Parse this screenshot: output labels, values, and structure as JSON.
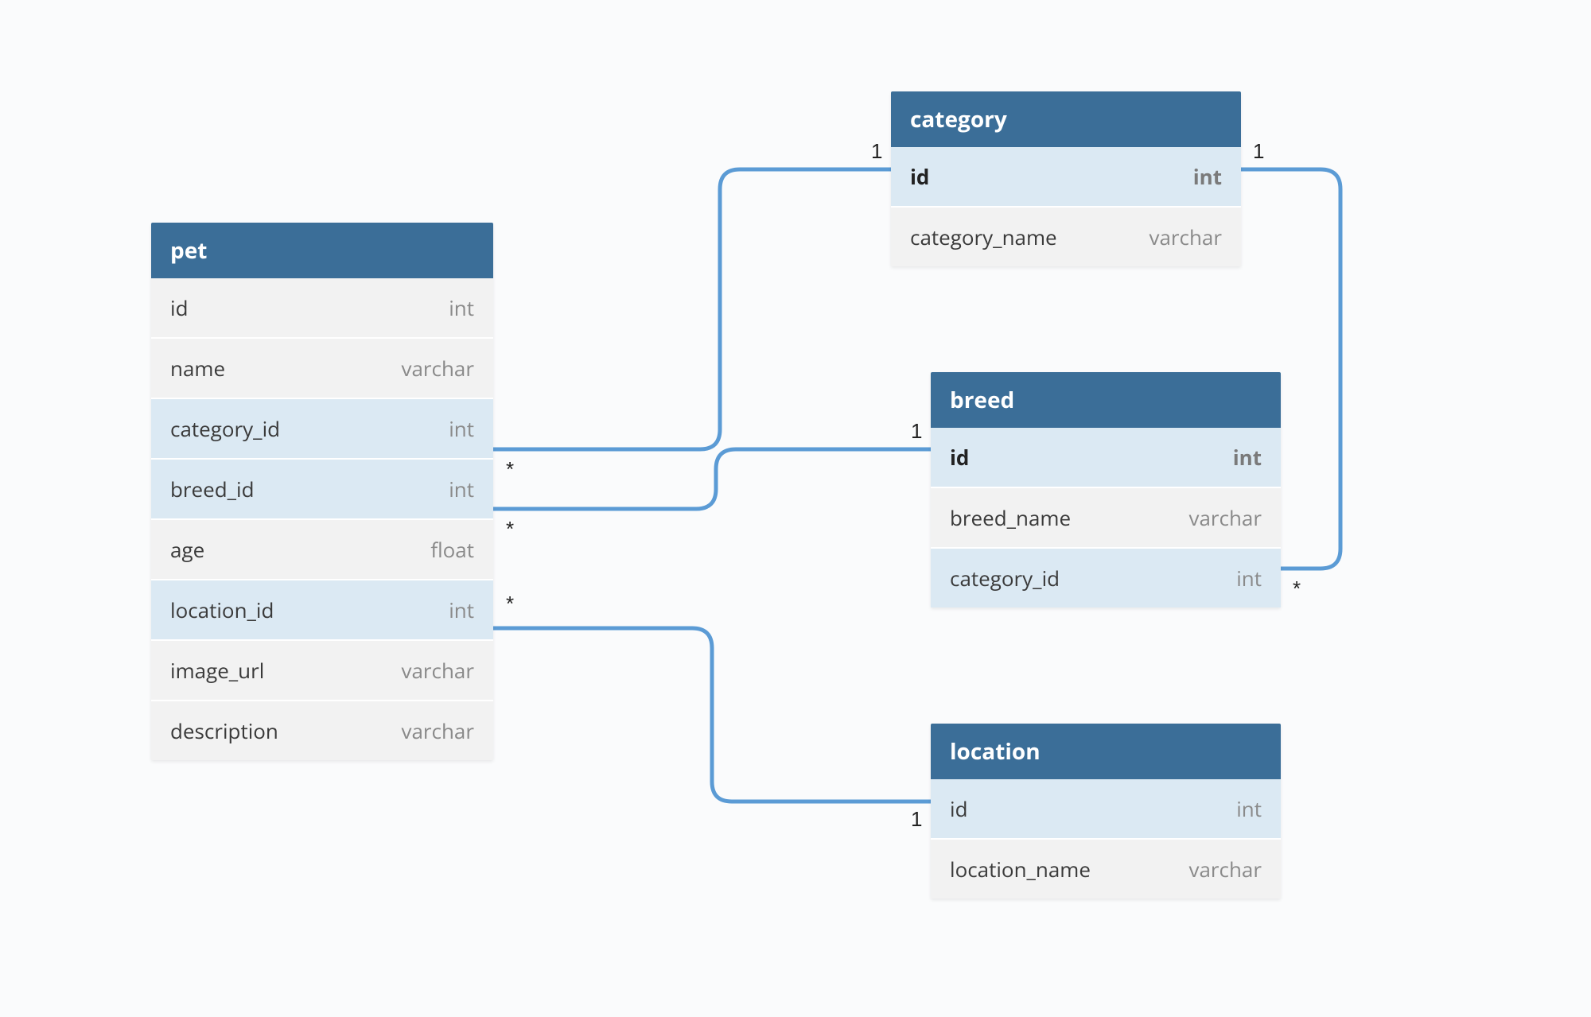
{
  "entities": {
    "pet": {
      "name": "pet",
      "columns": [
        {
          "name": "id",
          "type": "int",
          "key": "plain"
        },
        {
          "name": "name",
          "type": "varchar",
          "key": "plain"
        },
        {
          "name": "category_id",
          "type": "int",
          "key": "fk"
        },
        {
          "name": "breed_id",
          "type": "int",
          "key": "fk"
        },
        {
          "name": "age",
          "type": "float",
          "key": "plain"
        },
        {
          "name": "location_id",
          "type": "int",
          "key": "fk"
        },
        {
          "name": "image_url",
          "type": "varchar",
          "key": "plain"
        },
        {
          "name": "description",
          "type": "varchar",
          "key": "plain"
        }
      ]
    },
    "category": {
      "name": "category",
      "columns": [
        {
          "name": "id",
          "type": "int",
          "key": "pk"
        },
        {
          "name": "category_name",
          "type": "varchar",
          "key": "plain"
        }
      ]
    },
    "breed": {
      "name": "breed",
      "columns": [
        {
          "name": "id",
          "type": "int",
          "key": "pk"
        },
        {
          "name": "breed_name",
          "type": "varchar",
          "key": "plain"
        },
        {
          "name": "category_id",
          "type": "int",
          "key": "fk"
        }
      ]
    },
    "location": {
      "name": "location",
      "columns": [
        {
          "name": "id",
          "type": "int",
          "key": "fk"
        },
        {
          "name": "location_name",
          "type": "varchar",
          "key": "plain"
        }
      ]
    }
  },
  "cardinalities": {
    "pet_category_many": "*",
    "pet_breed_many": "*",
    "pet_location_many": "*",
    "category_one_left": "1",
    "category_one_right": "1",
    "breed_one": "1",
    "breed_category_many": "*",
    "location_one": "1"
  },
  "colors": {
    "header_bg": "#3b6e98",
    "fk_row_bg": "#dbe9f3",
    "row_bg": "#f2f2f2",
    "canvas_bg": "#fafbfc",
    "connector": "#5b9bd5"
  }
}
